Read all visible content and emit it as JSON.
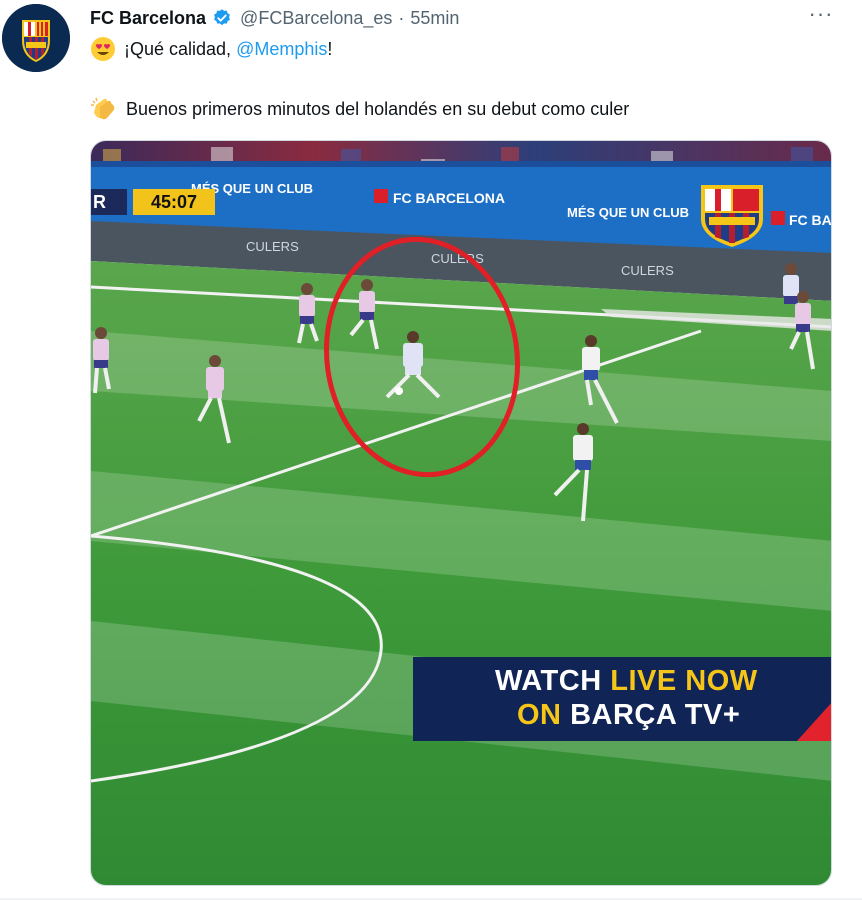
{
  "tweet": {
    "author_name": "FC Barcelona",
    "author_handle": "@FCBarcelona_es",
    "separator": "·",
    "time_ago": "55min",
    "more_label": "···",
    "line1_prefix": "¡Qué calidad, ",
    "line1_mention": "@Memphis",
    "line1_suffix": "!",
    "line2_text": "Buenos primeros minutos del holandés en su debut como culer"
  },
  "video": {
    "scorebug_team": "R",
    "scorebug_time": "45:07",
    "watch_live_1a": "WATCH ",
    "watch_live_1b": "LIVE NOW",
    "watch_live_2a": "ON ",
    "watch_live_2b": "BARÇA TV+",
    "board_texts": [
      "MÉS QUE UN CLUB",
      "FC BARCELONA",
      "MÉS QUE UN CLUB",
      "FC BA"
    ],
    "ad_texts": [
      "CULERS",
      "CULERS",
      "CULERS"
    ]
  },
  "colors": {
    "accent": "#1d9bf0",
    "pitch": "#3f9a3a",
    "highlight_circle": "#e01f26",
    "watch_bg": "#112456",
    "watch_yellow": "#f5c518"
  },
  "icons": [
    "barca-crest-icon",
    "verified-badge-icon",
    "more-icon",
    "heart-eyes-emoji-icon",
    "clapping-hands-emoji-icon"
  ]
}
